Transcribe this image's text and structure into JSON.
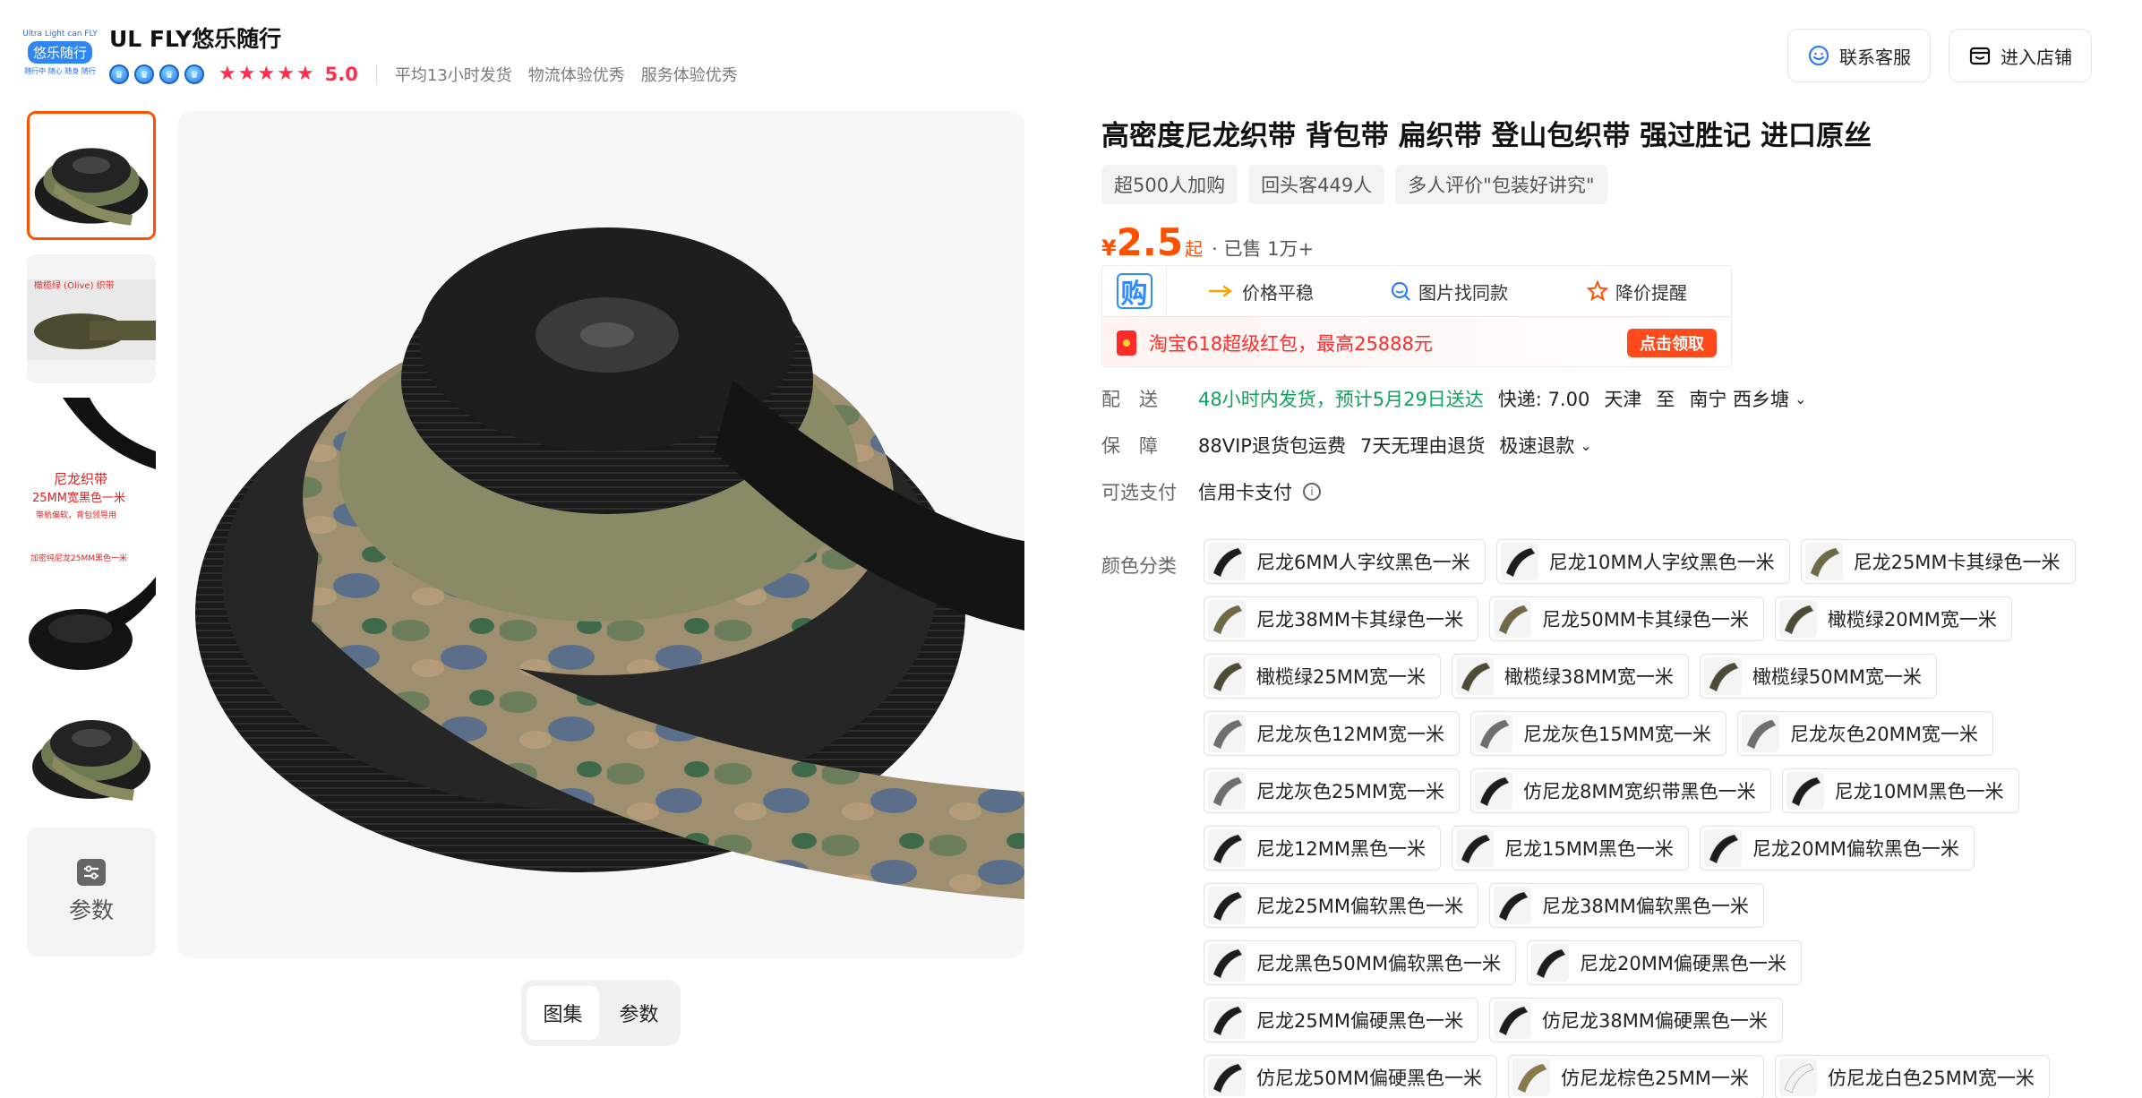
{
  "shop": {
    "logo_line1": "Ultra Light can FLY",
    "logo_line2": "悠乐随行",
    "logo_line3": "随行中 随心 随身 随行",
    "name": "UL FLY悠乐随行",
    "rating": "5.0",
    "tags": [
      "平均13小时发货",
      "物流体验优秀",
      "服务体验优秀"
    ],
    "service_label": "联系客服",
    "store_label": "进入店铺"
  },
  "gallery": {
    "thumbs": [
      "ribbon-roll-camo-black",
      "olive-webbing-sample",
      "black-webbing-25mm",
      "black-nylon-webbing-25mm",
      "ribbon-roll-camo-black"
    ],
    "thumb_texts": {
      "t2": "橄榄绿 (Olive) 织带",
      "t3a": "尼龙织带",
      "t3b": "25MM宽黑色一米",
      "t3c": "带航偏软，背包领导用",
      "t4": "加密纯尼龙25MM黑色一米"
    },
    "params_label": "参数",
    "view_tabs": [
      "图集",
      "参数"
    ]
  },
  "product": {
    "title": "高密度尼龙织带 背包带 扁织带 登山包织带 强过胜记 进口原丝",
    "chips": [
      "超500人加购",
      "回头客449人",
      "多人评价\"包装好讲究\""
    ],
    "price_currency": "¥",
    "price": "2.5",
    "price_suffix": "起",
    "sold": "· 已售 1万+",
    "promo_icon": "购",
    "promo_cells": [
      "价格平稳",
      "图片找同款",
      "降价提醒"
    ],
    "promo_banner": "淘宝618超级红包，最高25888元",
    "claim_label": "点击领取"
  },
  "shipping": {
    "label": "配　送",
    "eta": "48小时内发货，预计5月29日送达",
    "fee": "快递: 7.00",
    "from": "天津",
    "to_word": "至",
    "dest": "南宁 西乡塘"
  },
  "guarantee": {
    "label": "保　障",
    "items": [
      "88VIP退货包运费",
      "7天无理由退货",
      "极速退款"
    ]
  },
  "payment": {
    "label": "可选支付",
    "value": "信用卡支付"
  },
  "colors": {
    "label": "颜色分类",
    "rows": [
      [
        "尼龙6MM人字纹黑色一米",
        "尼龙10MM人字纹黑色一米",
        "尼龙25MM卡其绿色一米"
      ],
      [
        "尼龙38MM卡其绿色一米",
        "尼龙50MM卡其绿色一米",
        "橄榄绿20MM宽一米"
      ],
      [
        "橄榄绿25MM宽一米",
        "橄榄绿38MM宽一米",
        "橄榄绿50MM宽一米"
      ],
      [
        "尼龙灰色12MM宽一米",
        "尼龙灰色15MM宽一米",
        "尼龙灰色20MM宽一米"
      ],
      [
        "尼龙灰色25MM宽一米",
        "仿尼龙8MM宽织带黑色一米",
        "尼龙10MM黑色一米"
      ],
      [
        "尼龙12MM黑色一米",
        "尼龙15MM黑色一米",
        "尼龙20MM偏软黑色一米"
      ],
      [
        "尼龙25MM偏软黑色一米",
        "尼龙38MM偏软黑色一米"
      ],
      [
        "尼龙黑色50MM偏软黑色一米",
        "尼龙20MM偏硬黑色一米"
      ],
      [
        "尼龙25MM偏硬黑色一米",
        "仿尼龙38MM偏硬黑色一米"
      ],
      [
        "仿尼龙50MM偏硬黑色一米",
        "仿尼龙棕色25MM一米",
        "仿尼龙白色25MM宽一米"
      ]
    ],
    "swatch_colors": {
      "black": "#1d1d1d",
      "khaki": "#6f6a45",
      "olive": "#4d4b33",
      "gray": "#6e6e6e",
      "brown": "#8a7a45",
      "white": "#f2f2f2"
    }
  },
  "theme": {
    "accent": "#ff5000",
    "star": "#ff2e4d",
    "green": "#11a15c"
  }
}
